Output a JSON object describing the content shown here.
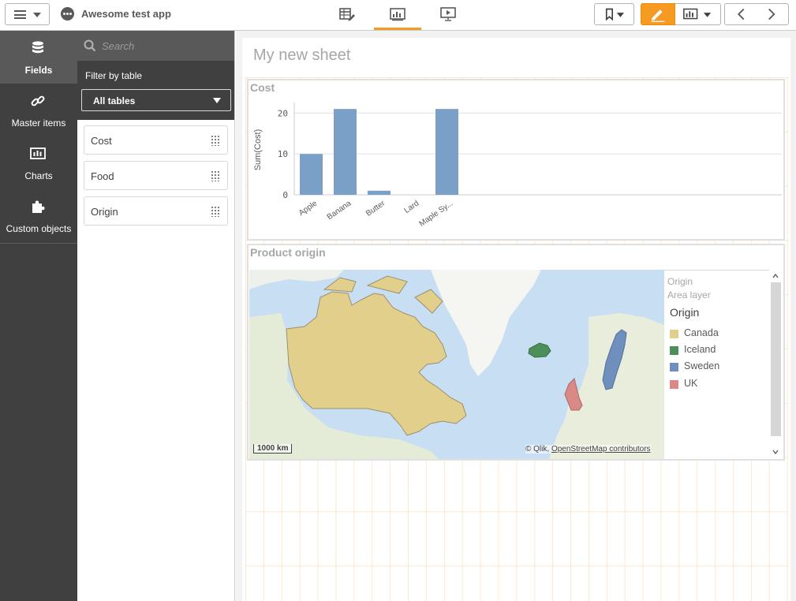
{
  "app": {
    "title": "Awesome test app"
  },
  "toolbar": {
    "nav_icons": [
      "data-manager-icon",
      "analysis-icon",
      "story-icon"
    ],
    "active_nav": "analysis-icon",
    "accent_color": "#f59b23"
  },
  "rail": {
    "items": [
      {
        "label": "Fields",
        "icon": "database-icon",
        "active": true
      },
      {
        "label": "Master items",
        "icon": "link-icon",
        "active": false
      },
      {
        "label": "Charts",
        "icon": "bar-chart-icon",
        "active": false
      },
      {
        "label": "Custom objects",
        "icon": "puzzle-icon",
        "active": false
      }
    ]
  },
  "fields_panel": {
    "search_placeholder": "Search",
    "filter_label": "Filter by table",
    "table_select": "All tables",
    "fields": [
      "Cost",
      "Food",
      "Origin"
    ]
  },
  "sheet": {
    "title": "My new sheet"
  },
  "cost_chart": {
    "title": "Cost",
    "chart_data": {
      "type": "bar",
      "title": "Cost",
      "xlabel": "",
      "ylabel": "Sum(Cost)",
      "categories": [
        "Apple",
        "Banana",
        "Butter",
        "Lard",
        "Maple Sy..."
      ],
      "values": [
        10,
        21,
        1,
        0,
        21
      ],
      "yticks": [
        0,
        10,
        20
      ],
      "ylim": [
        0,
        22
      ],
      "grid": true,
      "bar_color": "#7ba0c8"
    }
  },
  "map": {
    "title": "Product origin",
    "legend": {
      "header": "Origin",
      "layer": "Area layer",
      "dimension": "Origin",
      "items": [
        {
          "label": "Canada",
          "color": "#e3cf8c"
        },
        {
          "label": "Iceland",
          "color": "#4d8f5b"
        },
        {
          "label": "Sweden",
          "color": "#6f8fbf"
        },
        {
          "label": "UK",
          "color": "#d98a86"
        }
      ]
    },
    "scale": "1000 km",
    "attribution_prefix": "© Qlik,",
    "attribution_link": "OpenStreetMap contributors"
  }
}
